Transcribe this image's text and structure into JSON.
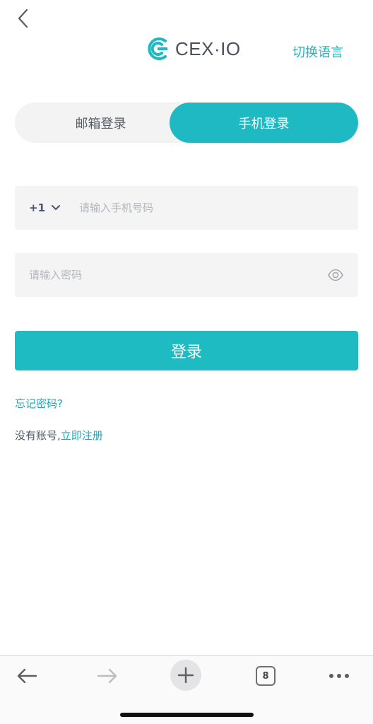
{
  "header": {
    "back_icon": "chevron-left-icon",
    "logo_text": "CEX·IO",
    "lang_switch": "切换语言"
  },
  "tabs": [
    {
      "label": "邮箱登录",
      "active": false
    },
    {
      "label": "手机登录",
      "active": true
    }
  ],
  "form": {
    "country_code": "+1",
    "phone_placeholder": "请输入手机号码",
    "password_placeholder": "请输入密码",
    "login_label": "登录"
  },
  "links": {
    "forgot": "忘记密码?",
    "no_account": "没有账号,",
    "register": "立即注册"
  },
  "browser_bar": {
    "tab_count": "8"
  },
  "colors": {
    "accent": "#1fb9c3",
    "link": "#1fa9b5",
    "field_bg": "#f4f4f4"
  }
}
